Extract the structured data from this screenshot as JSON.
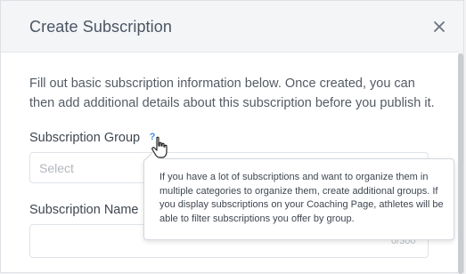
{
  "modal": {
    "title": "Create Subscription",
    "close_icon": "close-icon",
    "intro": "Fill out basic subscription information below. Once created, you can then add additional details about this subscription before you publish it."
  },
  "subscription_group": {
    "label": "Subscription Group",
    "help_glyph": "?",
    "help_icon": "question-icon",
    "select_value": "Select"
  },
  "subscription_name": {
    "label": "Subscription Name",
    "value": "",
    "counter": "0/300"
  },
  "tooltip": {
    "text": "If you have a lot of subscriptions and want to organize them in multiple categories to organize them, create additional groups. If you display subscriptions on your Coaching Page, athletes will be able to filter subscriptions you offer by group."
  },
  "colors": {
    "accent": "#3d8fe0",
    "text": "#545b64"
  }
}
